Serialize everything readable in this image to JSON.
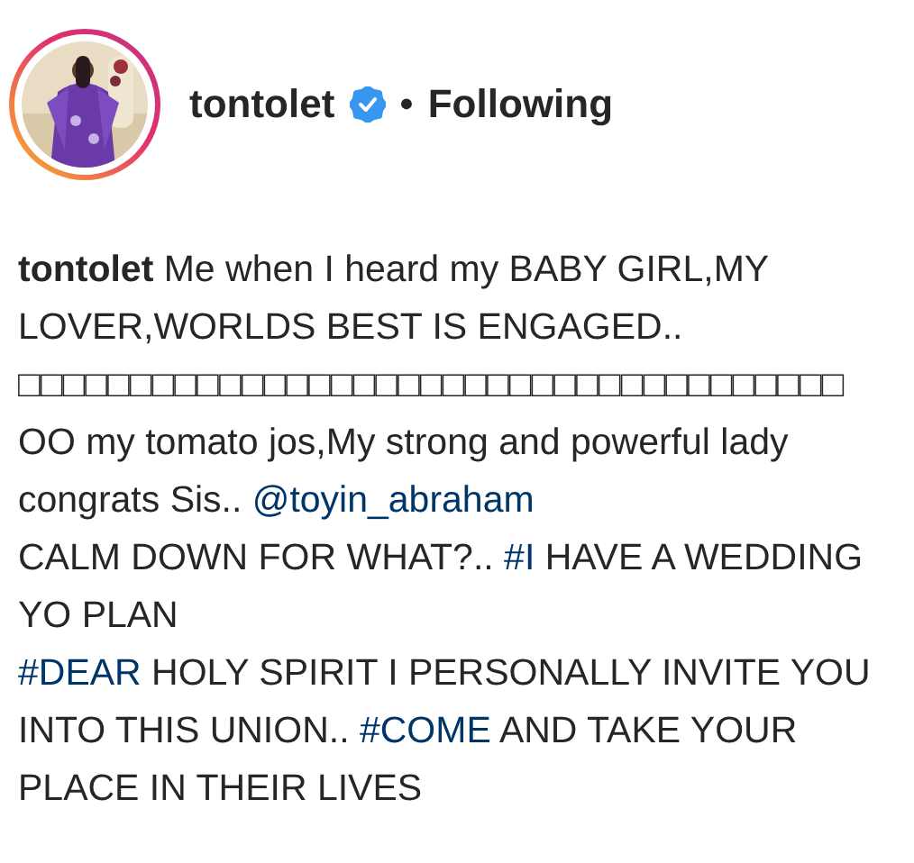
{
  "header": {
    "avatar": {
      "kind": "picture",
      "story_ring": true
    },
    "username": "tontolet",
    "verified": true,
    "separator": "•",
    "follow_status": "Following"
  },
  "caption": [
    [
      {
        "kind": "username",
        "text": "tontolet"
      },
      {
        "kind": "text",
        "text": " Me when I heard my BABY GIRL,MY LOVER,WORLDS BEST IS ENGAGED.."
      }
    ],
    [
      {
        "kind": "text",
        "text": "□□□□□□□□□□□□□□□□□□□□□□□□□□□□□□□□□□□□□"
      }
    ],
    [
      {
        "kind": "text",
        "text": "OO my tomato jos,My strong and powerful lady congrats Sis.. "
      },
      {
        "kind": "mention",
        "text": "@toyin_abraham"
      }
    ],
    [
      {
        "kind": "text",
        "text": "CALM DOWN FOR WHAT?.. "
      },
      {
        "kind": "hashtag",
        "text": "#I"
      },
      {
        "kind": "text",
        "text": " HAVE A WEDDING YO PLAN"
      }
    ],
    [
      {
        "kind": "hashtag",
        "text": "#DEAR"
      },
      {
        "kind": "text",
        "text": " HOLY SPIRIT I PERSONALLY INVITE YOU INTO THIS UNION.. "
      },
      {
        "kind": "hashtag",
        "text": "#COME"
      },
      {
        "kind": "text",
        "text": " AND TAKE YOUR PLACE IN THEIR LIVES"
      }
    ]
  ]
}
